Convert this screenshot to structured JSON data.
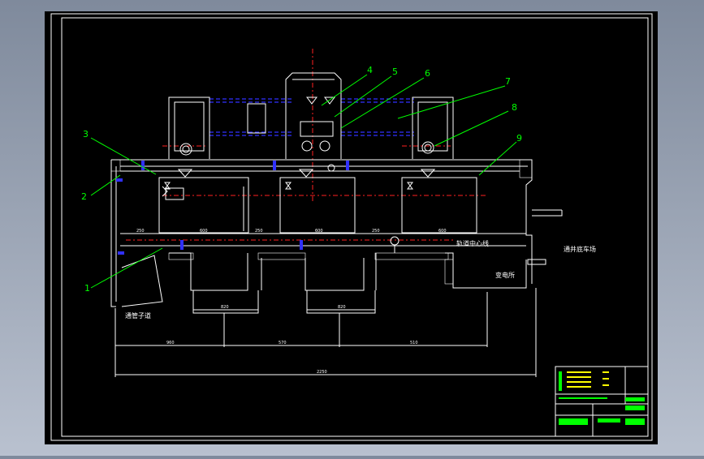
{
  "drawing": {
    "background": "#000000",
    "colors": {
      "white": "#ffffff",
      "green": "#00ff00",
      "red": "#ff2020",
      "blue": "#2b2bff",
      "yellow": "#ffff00",
      "grey_bg": "#8a93a3"
    },
    "callouts": [
      "1",
      "2",
      "3",
      "4",
      "5",
      "6",
      "7",
      "8",
      "9"
    ],
    "labels": {
      "shaft_center": "轨道中心线",
      "tunnel_right": "通井底车场",
      "substation": "变电所",
      "passage_left": "通管子道"
    },
    "dims": {
      "total": "2250",
      "d1": "960",
      "d2": "570",
      "d3": "510",
      "w1": "820",
      "w2": "820",
      "s1": "250",
      "s2": "250",
      "s3": "250",
      "s4": "600",
      "s5": "600",
      "s6": "600"
    }
  }
}
